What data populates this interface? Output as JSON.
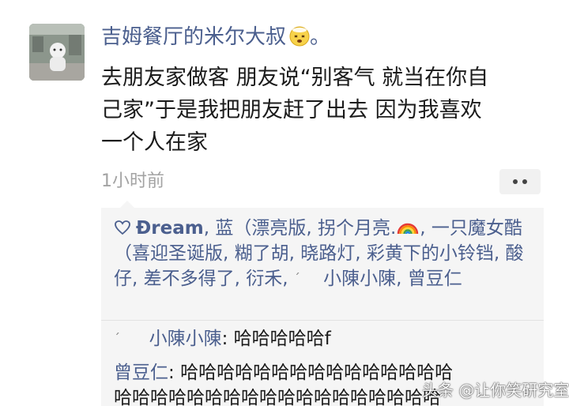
{
  "post": {
    "username": "吉姆餐厅的米尔大叔",
    "username_suffix": "。",
    "username_emoji": "dizzy-face-icon",
    "text_lines": [
      "去朋友家做客 朋友说“别客气 就当在你自",
      "己家”于是我把朋友赶了出去 因为我喜欢",
      "一个人在家"
    ],
    "time": "1小时前",
    "more_icon": "ellipsis-icon"
  },
  "likes": {
    "heart_icon": "heart-outline-icon",
    "names": [
      "Ðream",
      "蓝（漂亮版",
      "拐个月亮.",
      "一只魔女酷（喜迎圣诞版",
      "糊了胡",
      "晓路灯",
      "彩黄下的小铃铛",
      "酸仔",
      "差不多得了",
      "衍禾",
      "小陳小陳",
      "曾豆仁"
    ]
  },
  "comments": [
    {
      "name": "小陳小陳",
      "text": "哈哈哈哈哈f"
    },
    {
      "name": "曾豆仁",
      "text": "哈哈哈哈哈哈哈哈哈哈哈哈哈哈哈",
      "text2": "哈哈哈哈哈哈哈哈哈哈哈哈哈哈哈哈哈哈"
    }
  ],
  "watermark": "头条 @让你笑研究室",
  "colors": {
    "link": "#4b5f8e",
    "text": "#1b1b1b",
    "muted": "#a3a3a3",
    "panel": "#f5f5f5"
  }
}
